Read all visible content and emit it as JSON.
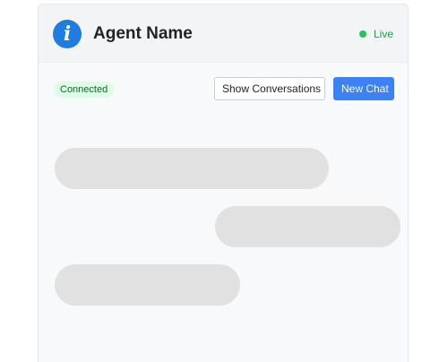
{
  "header": {
    "agent_icon": "info-icon",
    "agent_icon_glyph": "i",
    "agent_name": "Agent Name",
    "status_label": "Live",
    "status_color": "#22c55e"
  },
  "toolbar": {
    "connection_status": "Connected",
    "show_conversations_label": "Show Conversations",
    "new_chat_label": "New Chat"
  },
  "colors": {
    "accent": "#3b82f6",
    "agent_icon_bg": "#1f7ce0",
    "skeleton": "#e1e1e1"
  },
  "messages": [
    {
      "sender": "agent",
      "state": "loading"
    },
    {
      "sender": "user",
      "state": "loading"
    },
    {
      "sender": "agent",
      "state": "loading"
    }
  ]
}
